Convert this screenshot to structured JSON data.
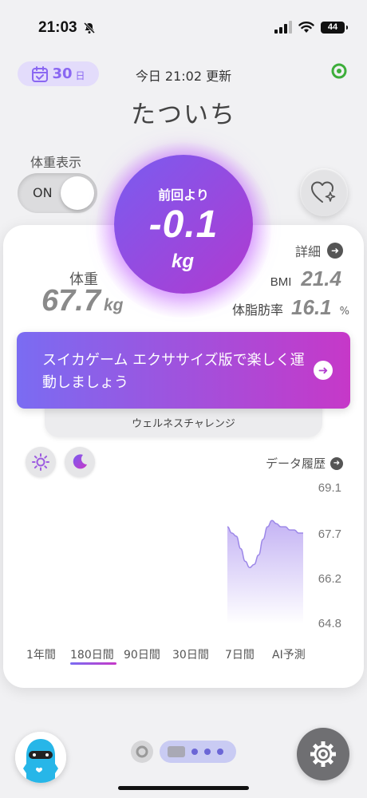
{
  "status_bar": {
    "time": "21:03",
    "battery": "44"
  },
  "header": {
    "days_value": "30",
    "days_unit": "日",
    "updated_text": "今日 21:02 更新",
    "user_name": "たついち"
  },
  "toggle": {
    "label": "体重表示",
    "state_text": "ON"
  },
  "diff": {
    "label": "前回より",
    "value": "-0.1",
    "unit": "kg"
  },
  "weight": {
    "label": "体重",
    "value": "67.7",
    "unit": "kg"
  },
  "details": {
    "link_label": "詳細"
  },
  "bmi": {
    "label": "BMI",
    "value": "21.4"
  },
  "body_fat": {
    "label": "体脂肪率",
    "value": "16.1",
    "unit": "%"
  },
  "banner": {
    "text": "スイカゲーム エクササイズ版で楽しく運動しましょう",
    "tab_label": "ウェルネスチャレンジ"
  },
  "history_link": "データ履歴",
  "chart_data": {
    "type": "area",
    "ylim": [
      64.8,
      69.1
    ],
    "y_ticks": [
      "69.1",
      "67.7",
      "66.2",
      "64.8"
    ],
    "series": [
      {
        "values": [
          67.9,
          67.7,
          67.6,
          67.2,
          66.8,
          66.6,
          66.7,
          67.0,
          67.5,
          67.9,
          68.1,
          68.0,
          67.9,
          67.9,
          67.8,
          67.8,
          67.7,
          67.7
        ]
      }
    ],
    "fill_color_top": "#c4b3f4",
    "fill_color_bottom": "#ffffff",
    "line_color": "#9d88e8"
  },
  "period_tabs": [
    {
      "label": "1年間"
    },
    {
      "label": "180日間"
    },
    {
      "label": "90日間"
    },
    {
      "label": "30日間"
    },
    {
      "label": "7日間"
    },
    {
      "label": "AI予測"
    }
  ],
  "active_period": "180日間",
  "colors": {
    "accent_purple": "#8a67f2",
    "gradient_start": "#7a5cf0",
    "gradient_end": "#b03ad0",
    "status_green": "#3dae3a"
  }
}
